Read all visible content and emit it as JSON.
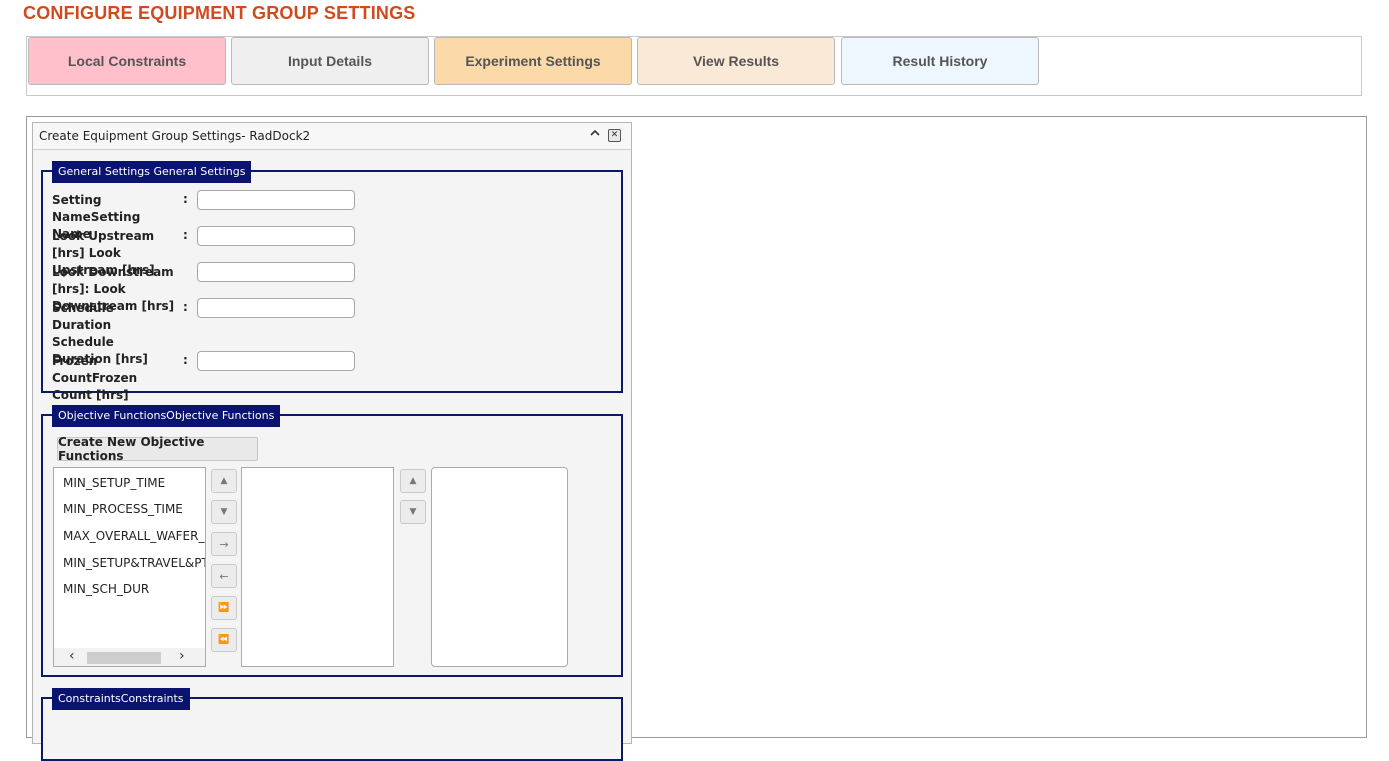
{
  "page": {
    "title": "CONFIGURE EQUIPMENT GROUP SETTINGS"
  },
  "tabs": [
    {
      "label": "Local Constraints",
      "color": "#ffc0cb"
    },
    {
      "label": "Input Details",
      "color": "#efefef"
    },
    {
      "label": "Experiment Settings",
      "color": "#fcd9a8"
    },
    {
      "label": "View Results",
      "color": "#fbe9d7"
    },
    {
      "label": "Result History",
      "color": "#eef6ff"
    }
  ],
  "dock": {
    "title": "Create Equipment Group Settings- RadDock2",
    "collapse_icon": "chevron-up",
    "close_icon": "close-box"
  },
  "general_settings": {
    "legend": "General Settings General Settings",
    "fields": [
      {
        "label": "Setting NameSetting Name",
        "value": ""
      },
      {
        "label": "Look Upstream [hrs] Look Upstream [hrs]",
        "value": ""
      },
      {
        "label": "Look Downstream [hrs]: Look Downstream [hrs]",
        "value": ""
      },
      {
        "label": "Schedule Duration Schedule Duration [hrs]",
        "value": ""
      },
      {
        "label": "Frozen CountFrozen Count [hrs]",
        "value": ""
      }
    ],
    "colon": ":"
  },
  "objective_functions": {
    "legend": "Objective FunctionsObjective Functions",
    "create_button": "Create New Objective Functions",
    "available": [
      "MIN_SETUP_TIME",
      "MIN_PROCESS_TIME",
      "MAX_OVERALL_WAFER_MOVES",
      "MIN_SETUP&TRAVEL&PT",
      "MIN_SCH_DUR"
    ],
    "selected": [],
    "weights": [],
    "buttons": {
      "move_up": "▲",
      "move_down": "▼",
      "transfer_to": "→",
      "transfer_from": "←",
      "transfer_all_to": "⏩",
      "transfer_all_from": "⏪",
      "scroll_left": "‹",
      "scroll_right": "›"
    }
  },
  "constraints": {
    "legend": "ConstraintsConstraints"
  }
}
